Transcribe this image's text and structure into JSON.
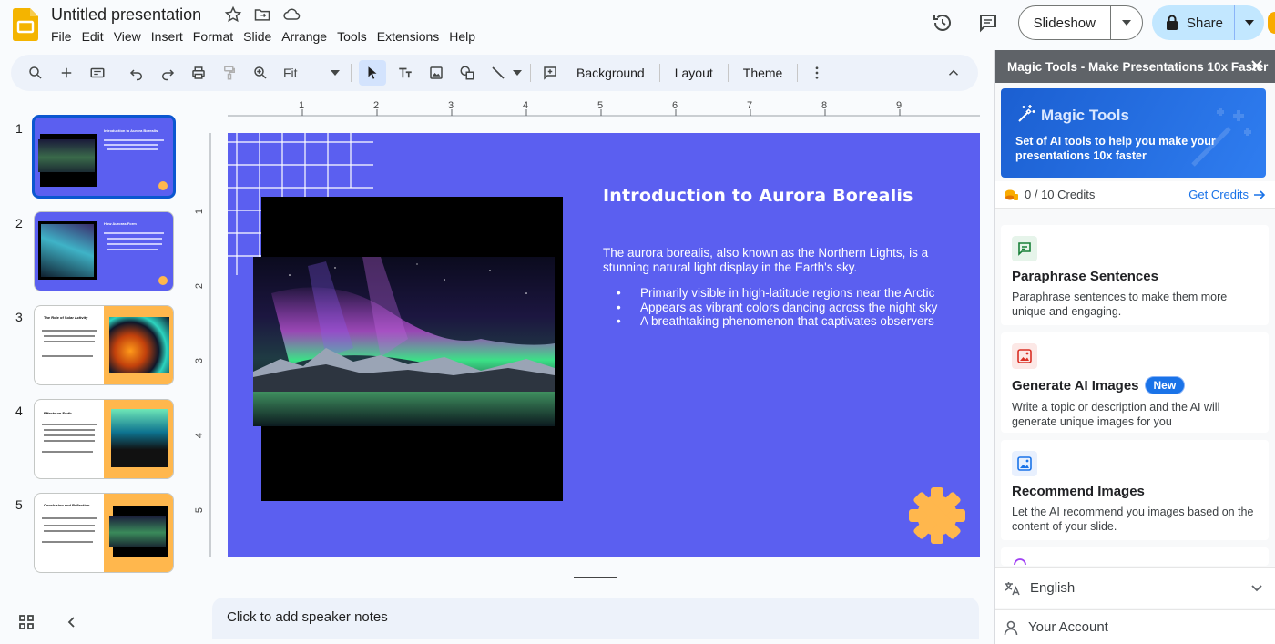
{
  "header": {
    "doc_title": "Untitled presentation",
    "menu": [
      "File",
      "Edit",
      "View",
      "Insert",
      "Format",
      "Slide",
      "Arrange",
      "Tools",
      "Extensions",
      "Help"
    ],
    "slideshow_label": "Slideshow",
    "share_label": "Share"
  },
  "toolbar": {
    "zoom_value": "Fit",
    "background_label": "Background",
    "layout_label": "Layout",
    "theme_label": "Theme"
  },
  "filmstrip": {
    "slides": [
      {
        "number": "1",
        "title": "Introduction to Aurora Borealis"
      },
      {
        "number": "2",
        "title": "How Auroras Form"
      },
      {
        "number": "3",
        "title": "The Role of Solar Activity"
      },
      {
        "number": "4",
        "title": "Effects on Earth"
      },
      {
        "number": "5",
        "title": "Conclusion and Reflection"
      }
    ]
  },
  "ruler": {
    "horizontal": [
      "1",
      "2",
      "3",
      "4",
      "5",
      "6",
      "7",
      "8",
      "9"
    ],
    "vertical": [
      "1",
      "2",
      "3",
      "4",
      "5"
    ]
  },
  "slide": {
    "title": "Introduction to Aurora Borealis",
    "paragraph": "The aurora borealis, also known as the Northern Lights, is a stunning natural light display in the Earth's sky.",
    "bullets": [
      "Primarily visible in high-latitude regions near the Arctic",
      "Appears as vibrant colors dancing across the night sky",
      "A breathtaking phenomenon that captivates observers"
    ],
    "background_color": "#5b5ff0",
    "accent_color": "#ffb74d"
  },
  "notes": {
    "placeholder": "Click to add speaker notes"
  },
  "panel": {
    "header": "Magic Tools - Make Presentations 10x Faster",
    "banner_title": "Magic Tools",
    "banner_desc": "Set of AI tools to help you make your presentations 10x faster",
    "credits": "0 / 10 Credits",
    "get_credits": "Get Credits",
    "tools": [
      {
        "title": "Paraphrase Sentences",
        "desc": "Paraphrase sentences to make them more unique and engaging."
      },
      {
        "title": "Generate AI Images",
        "badge": "New",
        "desc": "Write a topic or description and the AI will generate unique images for you"
      },
      {
        "title": "Recommend Images",
        "desc": "Let the AI recommend you images based on the content of your slide."
      }
    ],
    "language": "English",
    "account": "Your Account"
  }
}
